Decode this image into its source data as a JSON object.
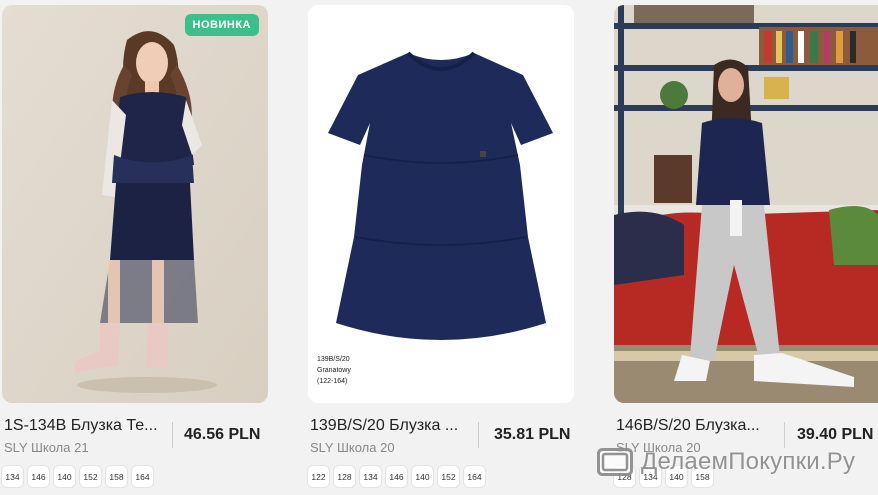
{
  "products": [
    {
      "badge": "НОВИНКА",
      "title": "1S-134B Блузка Те...",
      "brand": "SLY Школа 21",
      "price": "46.56 PLN",
      "sizes": [
        "134",
        "146",
        "140",
        "152",
        "158",
        "164"
      ]
    },
    {
      "title": "139B/S/20 Блузка ...",
      "brand": "SLY Школа 20",
      "price": "35.81 PLN",
      "sizes": [
        "122",
        "128",
        "134",
        "146",
        "140",
        "152",
        "164"
      ],
      "photo_label": [
        "139B/S/20",
        "Granatowy",
        "(122-164)"
      ]
    },
    {
      "title": "146B/S/20 Блузка...",
      "brand": "SLY Школа 20",
      "price": "39.40 PLN",
      "sizes": [
        "128",
        "134",
        "140",
        "158"
      ]
    }
  ],
  "watermark": {
    "text": "ДелаемПокупки.Ру",
    "icon": "card-icon"
  },
  "colors": {
    "badge": "#3cbf8a",
    "navy": "#1e2a5a",
    "background": "#f2f2f2"
  }
}
